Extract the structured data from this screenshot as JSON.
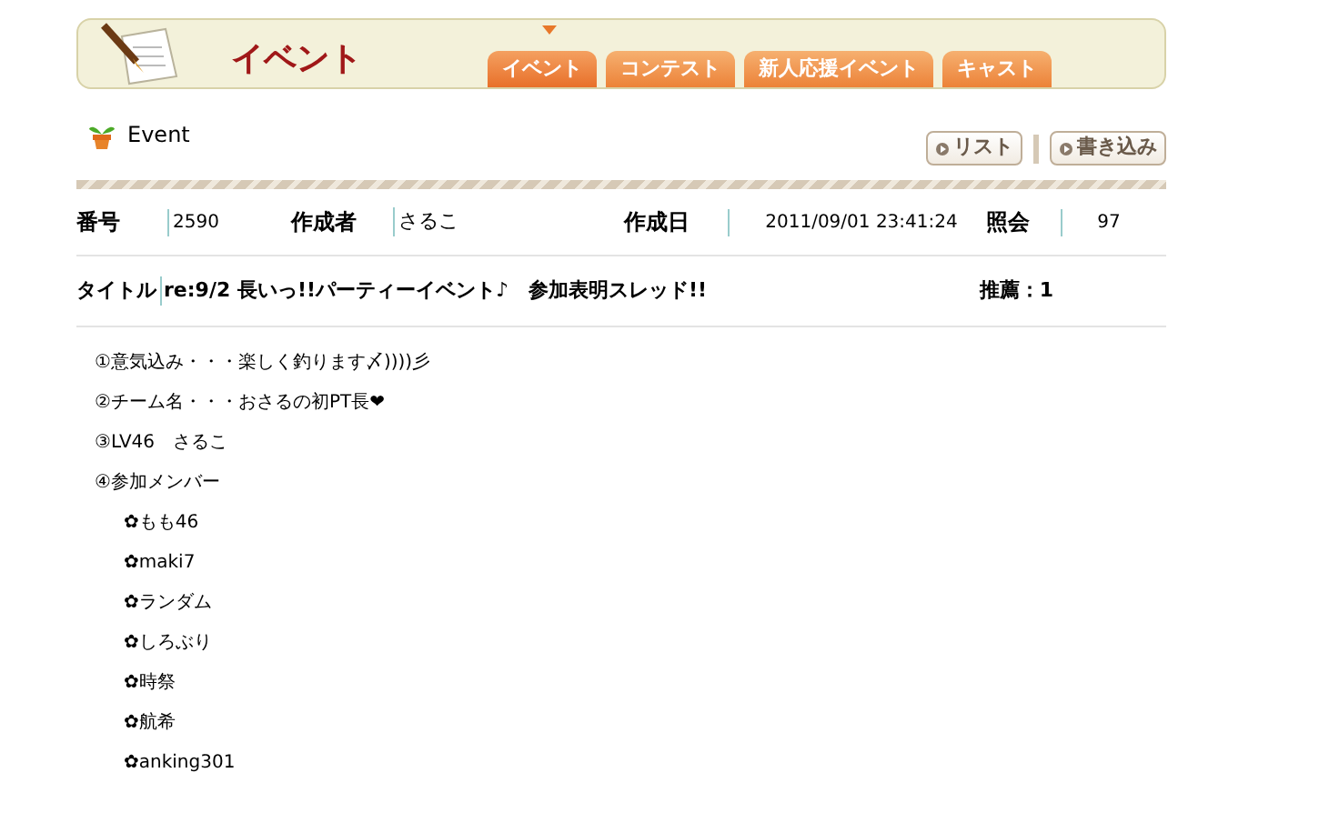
{
  "header": {
    "title": "イベント"
  },
  "tabs": [
    {
      "label": "イベント",
      "selected": true
    },
    {
      "label": "コンテスト",
      "selected": false
    },
    {
      "label": "新人応援イベント",
      "selected": false
    },
    {
      "label": "キャスト",
      "selected": false
    }
  ],
  "section": {
    "title": "Event"
  },
  "buttons": [
    "リスト",
    "書き込み"
  ],
  "meta": [
    {
      "label": "番号",
      "value": "2590"
    },
    {
      "label": "作成者",
      "value": "さるこ"
    },
    {
      "label": "作成日",
      "value": "2011/09/01 23:41:24"
    },
    {
      "label": "照会",
      "value": "97"
    }
  ],
  "post": {
    "title_label": "タイトル",
    "title": "re:9/2 長いっ!!パーティーイベント♪　参加表明スレッド!!",
    "recommend": "推薦：1"
  },
  "body": [
    {
      "text": "①意気込み・・・楽しく釣ります〆))))彡"
    },
    {
      "text": "②チーム名・・・おさるの初PT長❤"
    },
    {
      "text": "③LV46　さるこ"
    },
    {
      "text": "④参加メンバー",
      "children": [
        {
          "text": "✿もも46"
        },
        {
          "text": "✿maki7"
        },
        {
          "text": "✿ランダム"
        },
        {
          "text": "✿しろぶり"
        },
        {
          "text": "✿時祭"
        },
        {
          "text": "✿航希"
        },
        {
          "text": "✿anking301"
        }
      ]
    }
  ]
}
